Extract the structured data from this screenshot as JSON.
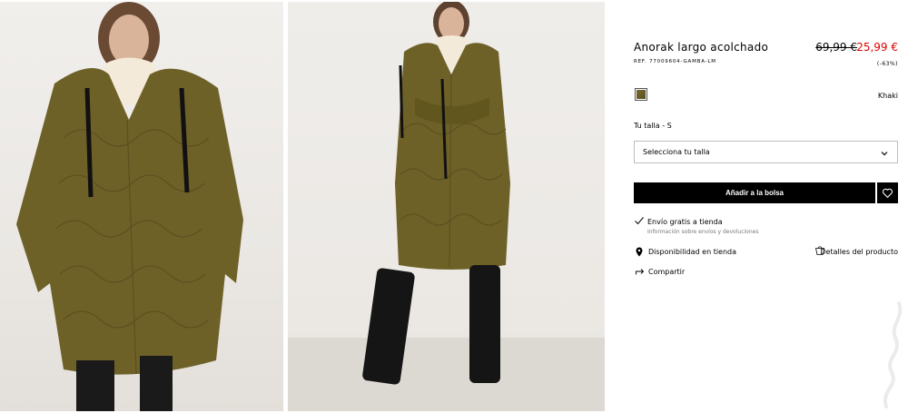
{
  "gallery": {
    "image_1": "product-photo-front-hands-on-hips",
    "image_2": "product-photo-arms-crossed-full-length"
  },
  "product": {
    "title": "Anorak largo acolchado",
    "reference": "REF. 77009604-GAMBA-LM",
    "price_old": "69,99 €",
    "price_new": "25,99 €",
    "discount": "(-63%)",
    "color_name": "Khaki",
    "price_new_color": "#e00000",
    "swatch_color": "#6b5c27"
  },
  "size": {
    "label": "Tu talla - S",
    "select_placeholder": "Selecciona tu talla"
  },
  "actions": {
    "add_to_bag": "Añadir a la bolsa",
    "favorite_icon": "heart-icon"
  },
  "shipping": {
    "title": "Envío gratis a tienda",
    "subtitle": "Información sobre envíos y devoluciones"
  },
  "links": {
    "store_availability": "Disponibilidad en tienda",
    "product_details": "Detalles del producto",
    "share": "Compartir"
  }
}
